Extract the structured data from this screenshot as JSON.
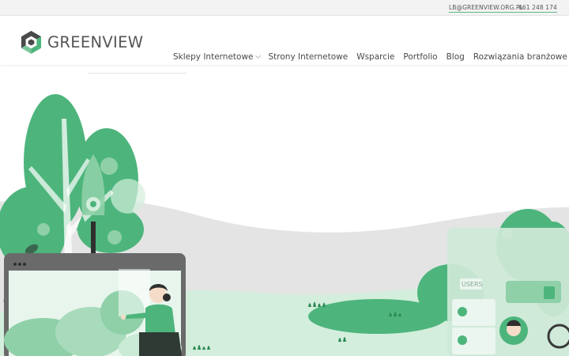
{
  "topbar": {
    "email": "LB@GREENVIEW.ORG.PL",
    "phone": "661 248 174"
  },
  "header": {
    "logo_text": "GREENVIEW",
    "nav": [
      {
        "label": "Sklepy Internetowe",
        "has_dropdown": true
      },
      {
        "label": "Strony Internetowe",
        "has_dropdown": false
      },
      {
        "label": "Wsparcie",
        "has_dropdown": false
      },
      {
        "label": "Portfolio",
        "has_dropdown": false
      },
      {
        "label": "Blog",
        "has_dropdown": false
      },
      {
        "label": "Rozwiązania branżowe",
        "has_dropdown": true
      }
    ]
  },
  "hero": {
    "card_text": "USERS"
  },
  "colors": {
    "brand_green": "#4db57c",
    "light_green": "#8fd0a8",
    "pale_green": "#c9ead5",
    "dark_green": "#2e8a57",
    "gray_hill": "#e4e4e4",
    "text_dark": "#4a4a4a"
  }
}
